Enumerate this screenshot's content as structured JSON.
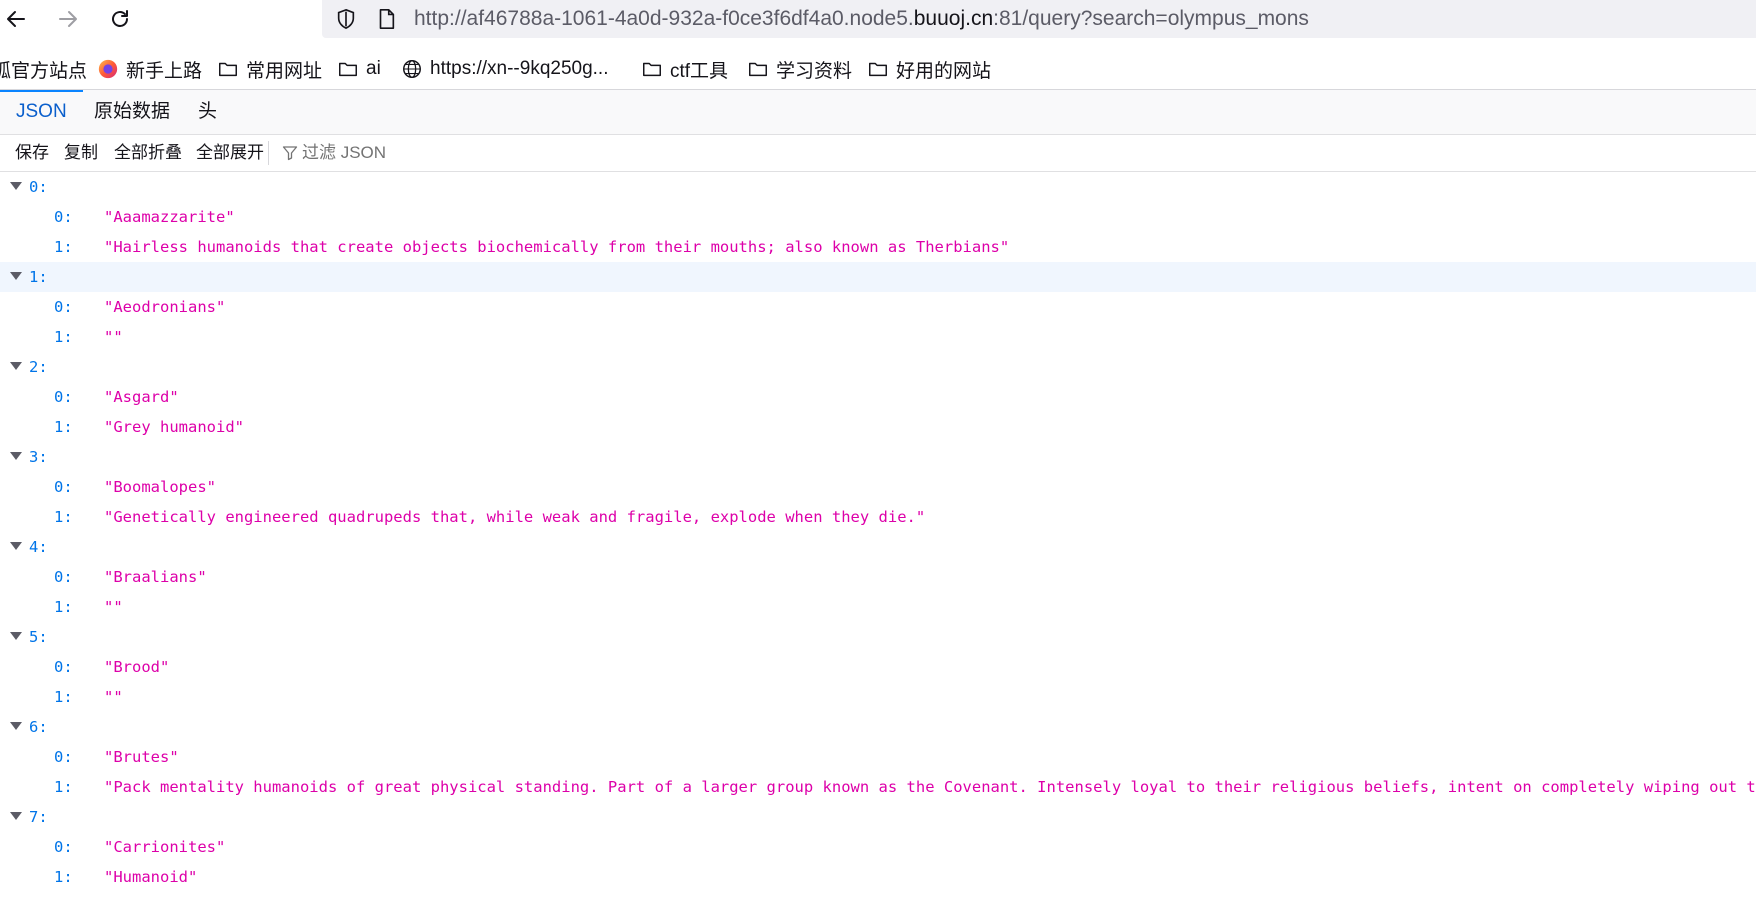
{
  "url": {
    "prefix": "http://af46788a-1061-4a0d-932a-f0ce3f6df4a0.node5.",
    "host": "buuoj.cn",
    "suffix": ":81/query?search=olympus_mons"
  },
  "bookmarks": [
    {
      "label": "狐官方站点",
      "icon": "none"
    },
    {
      "label": "新手上路",
      "icon": "firefox-icon"
    },
    {
      "label": "常用网址",
      "icon": "folder-icon"
    },
    {
      "label": "ai",
      "icon": "folder-icon"
    },
    {
      "label": "https://xn--9kq250g...",
      "icon": "globe-icon"
    },
    {
      "label": "ctf工具",
      "icon": "folder-icon"
    },
    {
      "label": "学习资料",
      "icon": "folder-icon"
    },
    {
      "label": "好用的网站",
      "icon": "folder-icon"
    }
  ],
  "tabs": [
    "JSON",
    "原始数据",
    "头"
  ],
  "toolbar": {
    "save": "保存",
    "copy": "复制",
    "collapse_all": "全部折叠",
    "expand_all": "全部展开",
    "filter_placeholder": "过滤 JSON"
  },
  "entries": [
    {
      "key": "0:",
      "items": [
        "\"Aaamazzarite\"",
        "\"Hairless humanoids that create objects biochemically from their mouths; also known as Therbians\""
      ]
    },
    {
      "key": "1:",
      "items": [
        "\"Aeodronians\"",
        "\"\""
      ],
      "highlighted": true
    },
    {
      "key": "2:",
      "items": [
        "\"Asgard\"",
        "\"Grey humanoid\""
      ]
    },
    {
      "key": "3:",
      "items": [
        "\"Boomalopes\"",
        "\"Genetically engineered quadrupeds that, while weak and fragile, explode when they die.\""
      ]
    },
    {
      "key": "4:",
      "items": [
        "\"Braalians\"",
        "\"\""
      ]
    },
    {
      "key": "5:",
      "items": [
        "\"Brood\"",
        "\"\""
      ]
    },
    {
      "key": "6:",
      "items": [
        "\"Brutes\"",
        "\"Pack mentality humanoids of great physical standing.  Part of a larger group known as the Covenant.  Intensely loyal to their religious beliefs, intent on completely wiping out the"
      ]
    },
    {
      "key": "7:",
      "items": [
        "\"Carrionites\"",
        "\"Humanoid\""
      ]
    }
  ],
  "colors": {
    "key": "#0074e8",
    "string": "#dd00a9",
    "active_tab": "#0a5fcc"
  }
}
